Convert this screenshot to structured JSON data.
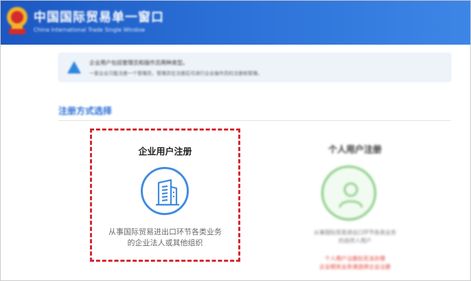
{
  "header": {
    "title": "中国国际贸易单一窗口",
    "subtitle": "China International Trade Single Window"
  },
  "notice": {
    "icon": "warning-triangle-icon",
    "line1": "企业用户包括管理员和操作员两种类型。",
    "line2": "一家企业只能注册一个管理员，管理员在注册后可进行企业操作员的注册和管理。"
  },
  "section": {
    "title": "注册方式选择"
  },
  "cards": {
    "enterprise": {
      "title": "企业用户注册",
      "icon": "building-icon",
      "desc_line1": "从事国际贸易进出口环节各类业务",
      "desc_line2": "的企业法人或其他组织"
    },
    "personal": {
      "title": "个人用户注册",
      "icon": "user-icon",
      "desc_line1": "从事国际贸易进出口环节各类业务",
      "desc_line2": "的自然人用户",
      "warning_line1": "个人用户注册后无法办理",
      "warning_line2": "企业相关业务请选择企业注册"
    }
  },
  "colors": {
    "header_blue": "#1b57c2",
    "accent_blue": "#3f8be0",
    "highlight_red": "#d4262e",
    "personal_green": "#7fc97a",
    "warning_red": "#e03a2f"
  }
}
